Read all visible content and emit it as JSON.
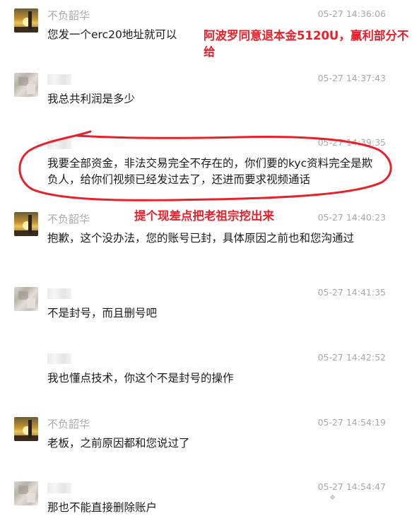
{
  "annotations": {
    "top": "阿波罗同意退本金5120U，赢利部分不给",
    "middle": "提个现差点把老祖宗挖出来"
  },
  "messages": [
    {
      "sender": "不负韶华",
      "time": "05-27 14:36:06",
      "text": "您发一个erc20地址就可以"
    },
    {
      "sender": "",
      "time": "05-27 14:37:43",
      "text": "我总共利润是多少"
    },
    {
      "sender": "",
      "time": "05-27 14:39:35",
      "text": "我要全部资金，非法交易完全不存在的，你们要的kyc资料完全是欺负人，给你们视频已经发过去了，还进而要求视频通话"
    },
    {
      "sender": "不负韶华",
      "time": "05-27 14:40:23",
      "text": "抱歉，这个没办法，您的账号已封，具体原因之前也和您沟通过"
    },
    {
      "sender": "",
      "time": "05-27 14:41:35",
      "text": "不是封号，而且删号吧"
    },
    {
      "sender": "",
      "time": "05-27 14:42:52",
      "text": "我也懂点技术，你这个不是封号的操作"
    },
    {
      "sender": "不负韶华",
      "time": "05-27 14:54:19",
      "text": "老板，之前原因都和您说过了"
    },
    {
      "sender": "",
      "time": "05-27 14:54:47",
      "text": "那也不能直接删除账户"
    }
  ],
  "colors": {
    "annotation": "#e8202a",
    "timestamp": "#a8a8a8",
    "sender": "#aaaaaa"
  }
}
